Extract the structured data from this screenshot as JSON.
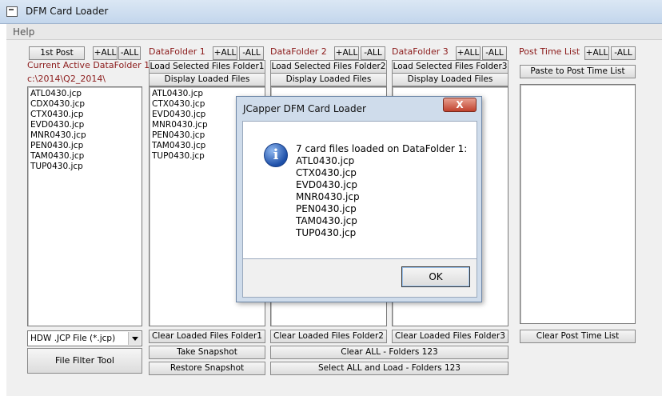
{
  "window": {
    "title": "DFM Card Loader"
  },
  "menu": {
    "help": "Help"
  },
  "col0": {
    "first_post": "1st Post",
    "add_all": "+ALL",
    "remove_all": "-ALL",
    "current_label": "Current Active DataFolder 1",
    "path": "c:\\2014\\Q2_2014\\",
    "files": [
      "ATL0430.jcp",
      "CDX0430.jcp",
      "CTX0430.jcp",
      "EVD0430.jcp",
      "MNR0430.jcp",
      "PEN0430.jcp",
      "TAM0430.jcp",
      "TUP0430.jcp"
    ],
    "filter_value": "HDW .JCP File (*.jcp)",
    "filter_tool": "File Filter Tool"
  },
  "folder1": {
    "label": "DataFolder 1",
    "add_all": "+ALL",
    "remove_all": "-ALL",
    "load": "Load Selected Files Folder1",
    "display": "Display Loaded Files",
    "files": [
      "ATL0430.jcp",
      "CTX0430.jcp",
      "EVD0430.jcp",
      "MNR0430.jcp",
      "PEN0430.jcp",
      "TAM0430.jcp",
      "TUP0430.jcp"
    ],
    "clear": "Clear Loaded Files Folder1"
  },
  "folder2": {
    "label": "DataFolder 2",
    "add_all": "+ALL",
    "remove_all": "-ALL",
    "load": "Load Selected Files Folder2",
    "display": "Display Loaded Files",
    "clear": "Clear Loaded Files Folder2"
  },
  "folder3": {
    "label": "DataFolder 3",
    "add_all": "+ALL",
    "remove_all": "-ALL",
    "load": "Load Selected Files Folder3",
    "display": "Display Loaded Files",
    "clear": "Clear Loaded Files Folder3"
  },
  "posttime": {
    "label": "Post Time List",
    "add_all": "+ALL",
    "remove_all": "-ALL",
    "paste": "Paste to Post Time List",
    "clear": "Clear Post Time List"
  },
  "actions": {
    "take_snapshot": "Take Snapshot",
    "restore_snapshot": "Restore Snapshot",
    "clear_all": "Clear ALL - Folders 123",
    "select_all_load": "Select ALL and Load - Folders 123"
  },
  "dialog": {
    "title": "JCapper DFM Card Loader",
    "close": "X",
    "message": "7 card files loaded on  DataFolder 1:",
    "files": [
      "ATL0430.jcp",
      "CTX0430.jcp",
      "EVD0430.jcp",
      "MNR0430.jcp",
      "PEN0430.jcp",
      "TAM0430.jcp",
      "TUP0430.jcp"
    ],
    "ok": "OK"
  }
}
